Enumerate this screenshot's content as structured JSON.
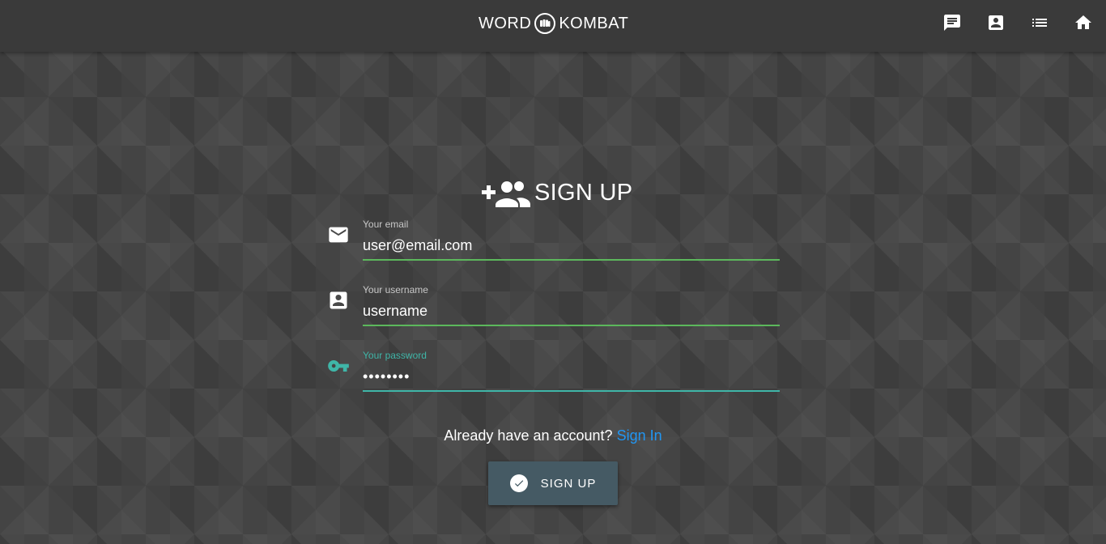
{
  "header": {
    "logo_left": "WORD",
    "logo_right": "KOMBAT",
    "icons": [
      "chat-icon",
      "account-box-icon",
      "list-icon",
      "home-icon"
    ]
  },
  "form": {
    "title": "SIGN UP",
    "fields": [
      {
        "label": "Your email",
        "value": "user@email.com",
        "icon": "email-icon"
      },
      {
        "label": "Your username",
        "value": "username",
        "icon": "account-box-icon"
      },
      {
        "label": "Your password",
        "value": "••••••••",
        "icon": "key-icon"
      }
    ],
    "already_text": "Already have an account?",
    "signin_link": "Sign In",
    "submit_label": "SIGN UP"
  },
  "colors": {
    "accent_teal": "#3fb6a8",
    "valid_green": "#5cb85c",
    "link_blue": "#2196f3",
    "button_bg": "#455a64"
  }
}
